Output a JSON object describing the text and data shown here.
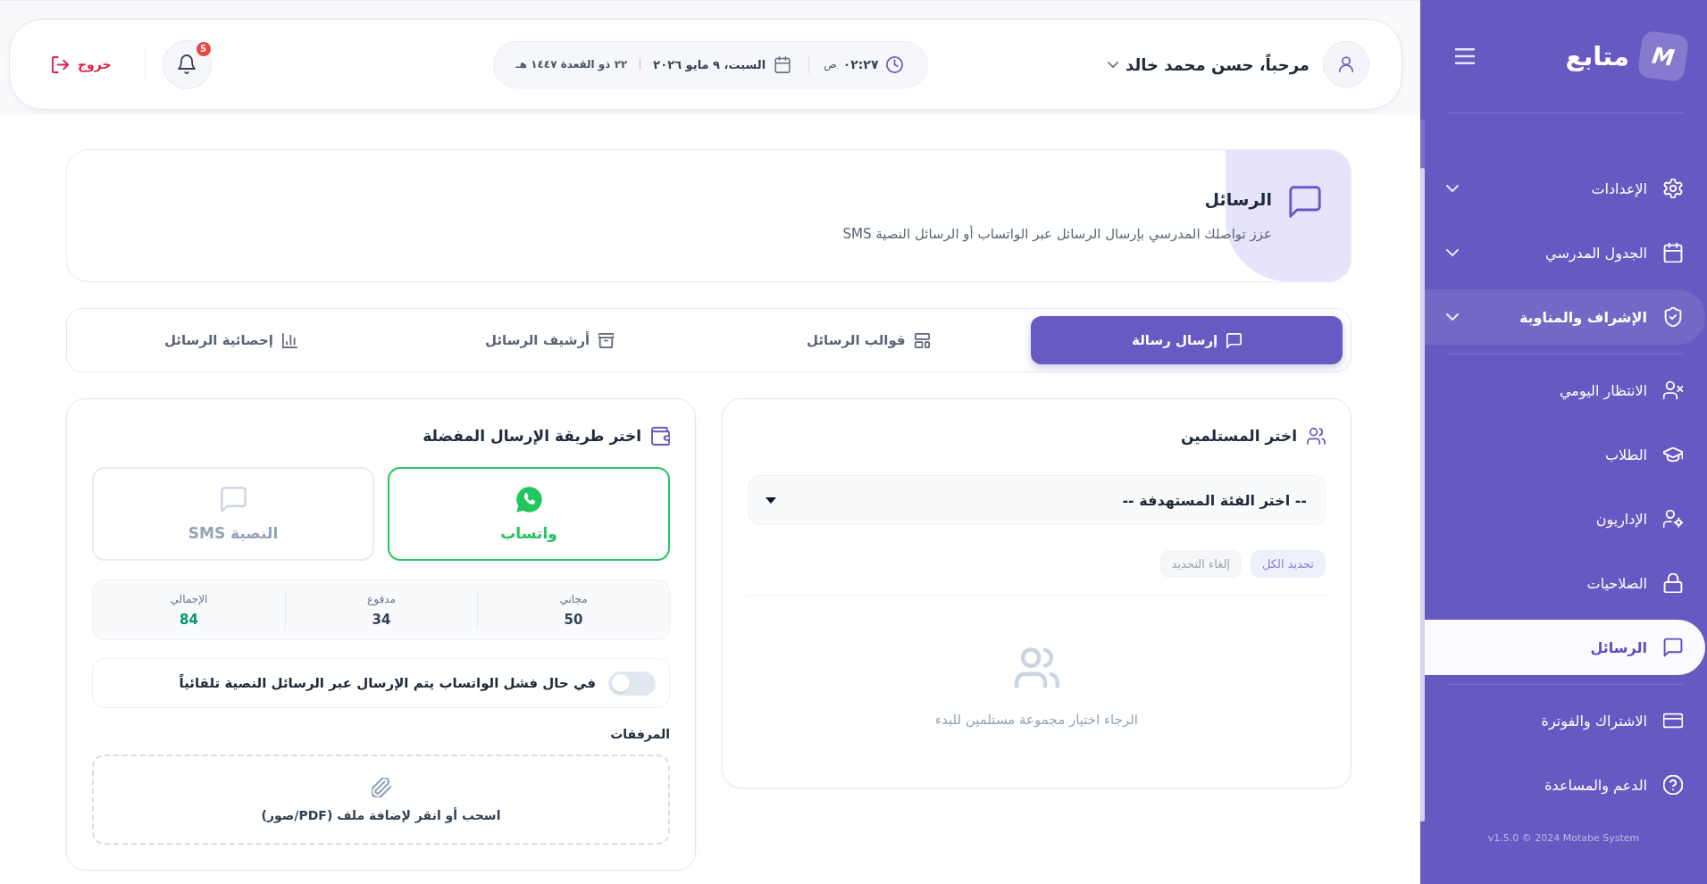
{
  "sidebar": {
    "brand": {
      "logo_letter": "M",
      "name": "متابع"
    },
    "sections": [
      {
        "items": [
          {
            "label": "الإعدادات",
            "has_submenu": true,
            "highlighted": false,
            "selected": false
          },
          {
            "label": "الجدول المدرسي",
            "has_submenu": true,
            "highlighted": false,
            "selected": false
          },
          {
            "label": "الإشراف والمناوبة",
            "has_submenu": true,
            "highlighted": true,
            "selected": false
          }
        ]
      },
      {
        "items": [
          {
            "label": "الانتظار اليومي",
            "has_submenu": false,
            "highlighted": false,
            "selected": false
          },
          {
            "label": "الطلاب",
            "has_submenu": false,
            "highlighted": false,
            "selected": false
          },
          {
            "label": "الإداريون",
            "has_submenu": false,
            "highlighted": false,
            "selected": false
          },
          {
            "label": "الصلاحيات",
            "has_submenu": false,
            "highlighted": false,
            "selected": false
          },
          {
            "label": "الرسائل",
            "has_submenu": false,
            "highlighted": false,
            "selected": true
          }
        ]
      },
      {
        "items": [
          {
            "label": "الاشتراك والفوترة",
            "has_submenu": false,
            "highlighted": false,
            "selected": false
          },
          {
            "label": "الدعم والمساعدة",
            "has_submenu": false,
            "highlighted": false,
            "selected": false
          }
        ]
      }
    ],
    "footer": "v1.5.0 © 2024 Motabe System"
  },
  "header": {
    "user": {
      "greeting": "مرحباً، حسن محمد خالد"
    },
    "clock": {
      "time": "٠٢:٢٧",
      "period": "ص"
    },
    "date": {
      "gregorian": "السبت، ٩ مايو ٢٠٢٦",
      "hijri": "٢٢ ذو القعدة ١٤٤٧ هـ"
    },
    "notifications": {
      "count": "5"
    },
    "logout": {
      "label": "خروج"
    }
  },
  "page_header": {
    "title": "الرسائل",
    "subtitle": "عزز تواصلك المدرسي بإرسال الرسائل عبر الواتساب أو الرسائل النصية SMS"
  },
  "tabs": [
    {
      "label": "إرسال رسالة",
      "selected": true
    },
    {
      "label": "قوالب الرسائل",
      "selected": false
    },
    {
      "label": "أرشيف الرسائل",
      "selected": false
    },
    {
      "label": "إحصائية الرسائل",
      "selected": false
    }
  ],
  "recipients": {
    "title": "اختر المستلمين",
    "select": {
      "value": "-- اختر الفئة المستهدفة --"
    },
    "actions": [
      {
        "label": "تحديد الكل",
        "kind": "primary"
      },
      {
        "label": "إلغاء التحديد",
        "kind": "secondary"
      }
    ],
    "empty_message": "الرجاء اختيار مجموعة مستلمين للبدء"
  },
  "send_method": {
    "title": "اختر طريقة الإرسال المفضلة",
    "options": [
      {
        "label": "واتساب",
        "kind": "whatsapp",
        "selected": true
      },
      {
        "label": "النصية SMS",
        "kind": "sms",
        "selected": false
      }
    ],
    "balance": [
      {
        "label": "مجاني",
        "value": "50",
        "kind": "count"
      },
      {
        "label": "مدفوع",
        "value": "34",
        "kind": "count"
      },
      {
        "label": "الإجمالي",
        "value": "84",
        "kind": "total"
      }
    ],
    "fallback": {
      "label": "في حال فشل الواتساب يتم الإرسال عبر الرسائل النصية تلقائياً",
      "on": false
    },
    "attachments": {
      "label": "المرفقات",
      "hint": "اسحب أو انقر لإضافة ملف (PDF/صور)"
    }
  }
}
